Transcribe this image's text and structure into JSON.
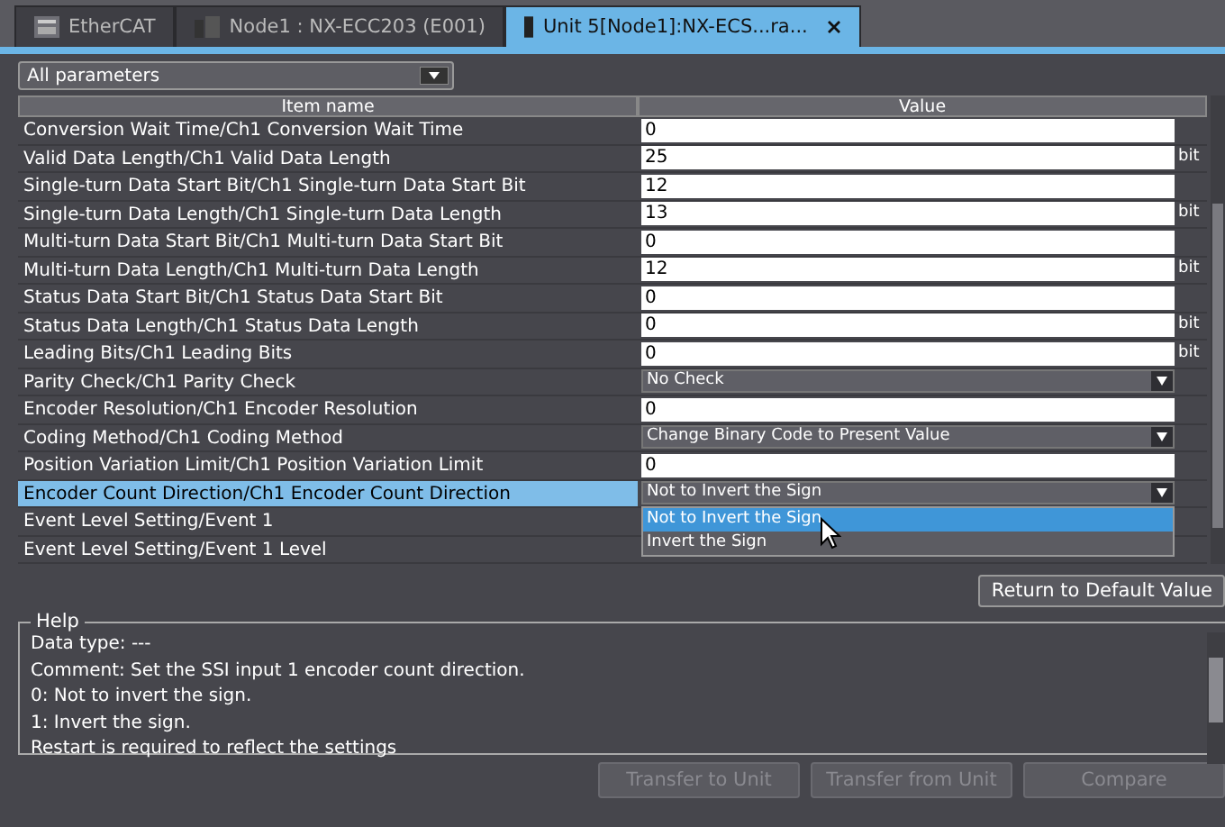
{
  "tabs": [
    {
      "label": "EtherCAT",
      "selected": false
    },
    {
      "label": "Node1 : NX-ECC203 (E001)",
      "selected": false
    },
    {
      "label": "Unit 5[Node1]:NX-ECS...ra...",
      "selected": true
    }
  ],
  "filter": {
    "value": "All parameters"
  },
  "table": {
    "columns": [
      "Item name",
      "Value"
    ],
    "rows": [
      {
        "name": "Conversion Wait Time/Ch1 Conversion Wait Time",
        "kind": "input",
        "value": "0",
        "selected": false
      },
      {
        "name": "Valid Data Length/Ch1 Valid Data Length",
        "kind": "input",
        "value": "25",
        "unit": "bit",
        "selected": false
      },
      {
        "name": "Single-turn Data Start Bit/Ch1 Single-turn Data Start Bit",
        "kind": "input",
        "value": "12",
        "selected": false
      },
      {
        "name": "Single-turn Data Length/Ch1 Single-turn Data Length",
        "kind": "input",
        "value": "13",
        "unit": "bit",
        "selected": false
      },
      {
        "name": "Multi-turn Data Start Bit/Ch1 Multi-turn Data Start Bit",
        "kind": "input",
        "value": "0",
        "selected": false
      },
      {
        "name": "Multi-turn Data Length/Ch1 Multi-turn Data Length",
        "kind": "input",
        "value": "12",
        "unit": "bit",
        "selected": false
      },
      {
        "name": "Status Data Start Bit/Ch1 Status Data Start Bit",
        "kind": "input",
        "value": "0",
        "selected": false
      },
      {
        "name": "Status Data Length/Ch1 Status Data Length",
        "kind": "input",
        "value": "0",
        "unit": "bit",
        "selected": false
      },
      {
        "name": "Leading Bits/Ch1 Leading Bits",
        "kind": "input",
        "value": "0",
        "unit": "bit",
        "selected": false
      },
      {
        "name": "Parity Check/Ch1 Parity Check",
        "kind": "dropdown",
        "value": "No Check",
        "selected": false
      },
      {
        "name": "Encoder Resolution/Ch1 Encoder Resolution",
        "kind": "input",
        "value": "0",
        "selected": false
      },
      {
        "name": "Coding Method/Ch1 Coding Method",
        "kind": "dropdown",
        "value": "Change Binary Code to Present Value",
        "selected": false
      },
      {
        "name": "Position Variation Limit/Ch1 Position Variation Limit",
        "kind": "input",
        "value": "0",
        "selected": false
      },
      {
        "name": "Encoder Count Direction/Ch1 Encoder Count Direction",
        "kind": "dropdown",
        "value": "Not to Invert the Sign",
        "selected": true,
        "options": [
          {
            "label": "Not to Invert the Sign",
            "selected": true
          },
          {
            "label": "Invert the Sign",
            "selected": false
          }
        ]
      },
      {
        "name": "Event Level Setting/Event 1",
        "kind": "hidden",
        "selected": false
      },
      {
        "name": "Event Level Setting/Event 1 Level",
        "kind": "hidden",
        "selected": false
      }
    ]
  },
  "default_button": "Return to Default Value",
  "help": {
    "title": "Help",
    "lines": [
      "Data type: ---",
      "Comment: Set the SSI input 1 encoder count direction.",
      "0: Not to invert the sign.",
      "1: Invert the sign.",
      "Restart is required to reflect the settings"
    ]
  },
  "buttons": [
    {
      "label": "Transfer to Unit",
      "disabled": true
    },
    {
      "label": "Transfer from Unit",
      "disabled": true
    },
    {
      "label": "Compare",
      "disabled": true
    }
  ]
}
